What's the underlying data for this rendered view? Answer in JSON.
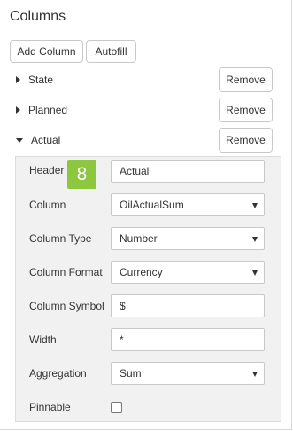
{
  "panel": {
    "title": "Columns"
  },
  "toolbar": {
    "add_column": "Add Column",
    "autofill": "Autofill"
  },
  "columns": [
    {
      "label": "State",
      "expanded": false,
      "remove": "Remove"
    },
    {
      "label": "Planned",
      "expanded": false,
      "remove": "Remove"
    },
    {
      "label": "Actual",
      "expanded": true,
      "remove": "Remove"
    }
  ],
  "details": {
    "header_label": "Header",
    "header_value": "Actual",
    "column_label": "Column",
    "column_value": "OilActualSum",
    "type_label": "Column Type",
    "type_value": "Number",
    "format_label": "Column Format",
    "format_value": "Currency",
    "symbol_label": "Column Symbol",
    "symbol_value": "$",
    "width_label": "Width",
    "width_value": "*",
    "aggregation_label": "Aggregation",
    "aggregation_value": "Sum",
    "pinnable_label": "Pinnable",
    "pinnable_checked": false
  },
  "badge": {
    "text": "8",
    "color": "#8dc63f"
  },
  "icons": {
    "collapsed": "caret-right-icon",
    "expanded": "caret-down-icon",
    "dropdown": "triangle-down-icon"
  }
}
